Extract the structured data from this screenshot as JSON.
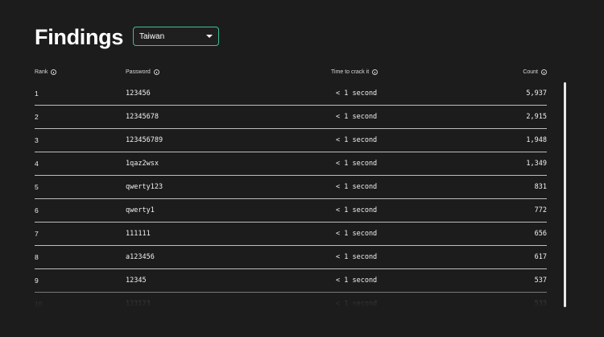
{
  "page": {
    "title": "Findings"
  },
  "filter": {
    "selected": "Taiwan"
  },
  "table": {
    "columns": {
      "rank": "Rank",
      "password": "Password",
      "time": "Time to crack it",
      "count": "Count"
    },
    "rows": [
      {
        "rank": "1",
        "password": "123456",
        "time": "< 1 second",
        "count": "5,937"
      },
      {
        "rank": "2",
        "password": "12345678",
        "time": "< 1 second",
        "count": "2,915"
      },
      {
        "rank": "3",
        "password": "123456789",
        "time": "< 1 second",
        "count": "1,948"
      },
      {
        "rank": "4",
        "password": "1qaz2wsx",
        "time": "< 1 second",
        "count": "1,349"
      },
      {
        "rank": "5",
        "password": "qwerty123",
        "time": "< 1 second",
        "count": "831"
      },
      {
        "rank": "6",
        "password": "qwerty1",
        "time": "< 1 second",
        "count": "772"
      },
      {
        "rank": "7",
        "password": "111111",
        "time": "< 1 second",
        "count": "656"
      },
      {
        "rank": "8",
        "password": "a123456",
        "time": "< 1 second",
        "count": "617"
      },
      {
        "rank": "9",
        "password": "12345",
        "time": "< 1 second",
        "count": "537"
      },
      {
        "rank": "10",
        "password": "123123",
        "time": "< 1 second",
        "count": "533"
      }
    ]
  },
  "icons": {
    "info": "info-icon",
    "dropdown": "chevron-down-icon"
  },
  "colors": {
    "background": "#1c1c1c",
    "accent_border": "#3fbf8f",
    "text": "#f0f0f0"
  }
}
